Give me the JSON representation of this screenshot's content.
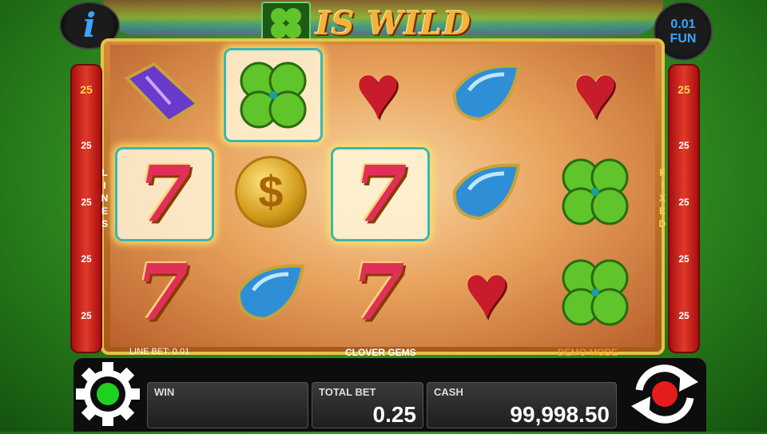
{
  "header": {
    "title": "IS WILD",
    "info_icon": "i",
    "fun_badge": {
      "amount": "0.01",
      "label": "FUN"
    }
  },
  "side_labels": {
    "left": "LINES",
    "right": "FIXED"
  },
  "lines_left": [
    "25",
    "25",
    "25",
    "25",
    "25"
  ],
  "lines_right": [
    "25",
    "25",
    "25",
    "25",
    "25"
  ],
  "reels": [
    [
      "purple-gem",
      "seven",
      "seven"
    ],
    [
      "clover",
      "coin",
      "blue-drop"
    ],
    [
      "red-heart",
      "seven",
      "seven"
    ],
    [
      "blue-drop",
      "blue-drop",
      "red-heart"
    ],
    [
      "red-heart",
      "clover",
      "clover"
    ]
  ],
  "winning_cells": [
    "0-1",
    "1-0",
    "2-1"
  ],
  "footer_info": {
    "line_bet": "LINE BET: 0.01",
    "game_name": "CLOVER GEMS",
    "mode": "DEMO MODE"
  },
  "panels": {
    "win": {
      "label": "WIN",
      "value": ""
    },
    "total_bet": {
      "label": "TOTAL BET",
      "value": "0.25"
    },
    "cash": {
      "label": "CASH",
      "value": "99,998.50"
    }
  },
  "icons": {
    "settings": "gear-icon",
    "spin": "spin-icon",
    "info": "info-icon"
  },
  "colors": {
    "accent_gold": "#f4b23a",
    "line_bar_red": "#e03a2a",
    "win_highlight": "#ffe36a",
    "fixed_text": "#ffd54a"
  }
}
